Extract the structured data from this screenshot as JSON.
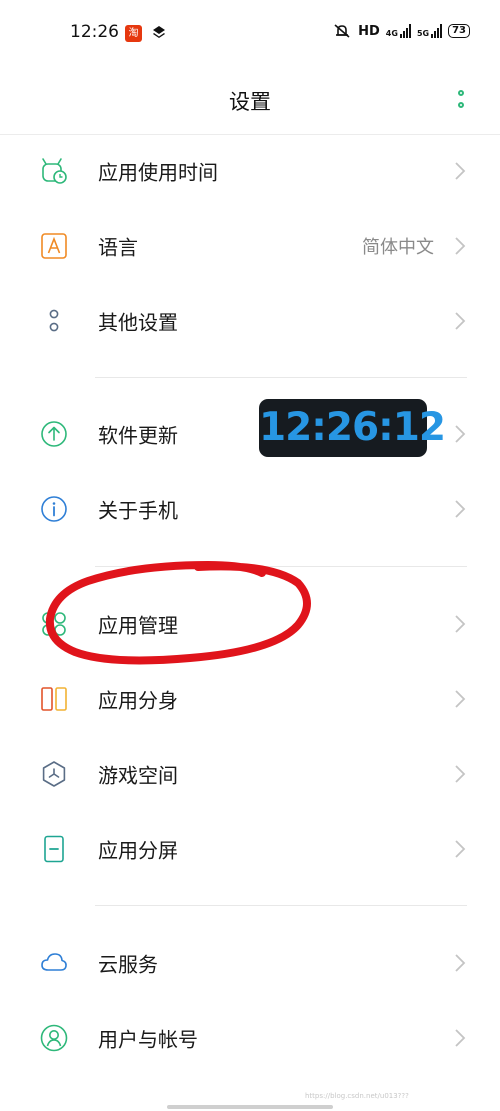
{
  "status_bar": {
    "time": "12:26",
    "taobao_badge": "淘",
    "hd": "HD",
    "net1": "4G",
    "net2": "5G",
    "battery": "73"
  },
  "header": {
    "title": "设置"
  },
  "settings": {
    "app_usage_time": "应用使用时间",
    "language": "语言",
    "language_value": "简体中文",
    "other_settings": "其他设置",
    "software_update": "软件更新",
    "about_phone": "关于手机",
    "app_management": "应用管理",
    "app_clone": "应用分身",
    "game_space": "游戏空间",
    "split_screen": "应用分屏",
    "cloud_service": "云服务",
    "user_account": "用户与帐号"
  },
  "overlay": {
    "clock": "12:26:12"
  },
  "watermark": "https://blog.csdn.net/u013???",
  "colors": {
    "green": "#2eb87a",
    "orange": "#f08a24",
    "blue": "#2f7fd6",
    "slate": "#5a6d86",
    "annotation_red": "#e0141b"
  }
}
